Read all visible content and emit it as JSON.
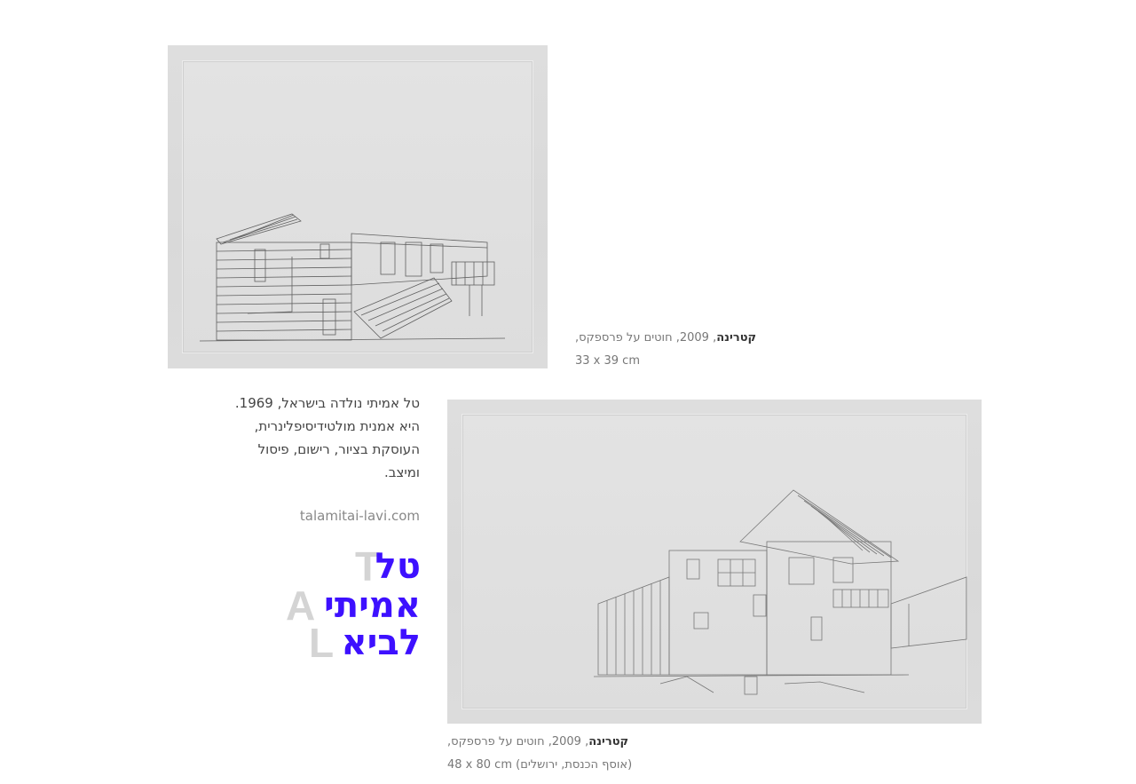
{
  "artworks": [
    {
      "title": "קטרינה",
      "details": ", 2009, חוטים על פרספקס,",
      "dimensions": "33 x 39 cm"
    },
    {
      "title": "קטרינה",
      "details": ", 2009, חוטים על פרספקס,",
      "dimensions": "48 x 80 cm (אוסף הכנסת, ירושלים)"
    }
  ],
  "bio": {
    "lines": [
      "טל אמיתי נולדה בישראל, 1969.",
      "היא אמנית מולטידיסיפלינרית,",
      "העוסקת בציור, רישום, פיסול",
      "ומיצב."
    ],
    "website": "talamitai-lavi.com"
  },
  "logo": {
    "hebrew_lines": [
      "טל",
      "אמיתי",
      "לביא"
    ],
    "latin_letters": [
      "T",
      "A",
      "L"
    ],
    "colors": {
      "hebrew": "#3d10ff",
      "latin": "#d4d4d4"
    }
  }
}
